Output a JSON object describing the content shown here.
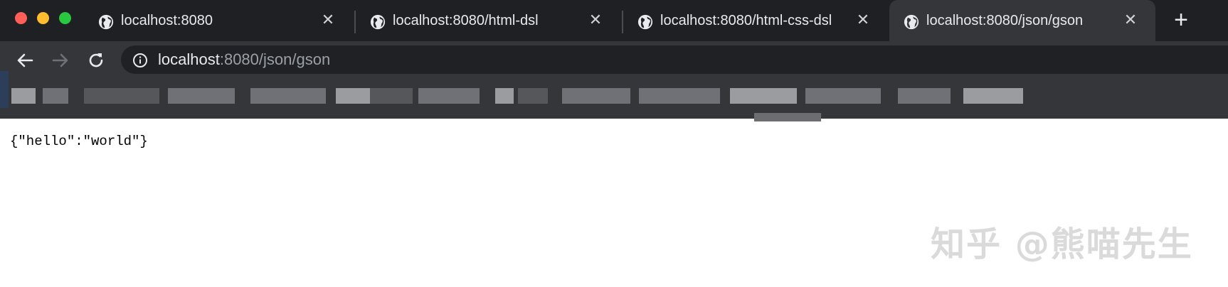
{
  "window": {
    "traffic_lights": [
      "close",
      "minimize",
      "maximize"
    ]
  },
  "tabs": [
    {
      "title": "localhost:8080",
      "icon": "globe-icon",
      "active": false
    },
    {
      "title": "localhost:8080/html-dsl",
      "icon": "globe-icon",
      "active": false
    },
    {
      "title": "localhost:8080/html-css-dsl",
      "icon": "globe-icon",
      "active": false
    },
    {
      "title": "localhost:8080/json/gson",
      "icon": "globe-icon",
      "active": true
    }
  ],
  "new_tab_label": "+",
  "toolbar": {
    "back_icon": "arrow-left-icon",
    "forward_icon": "arrow-right-icon",
    "reload_icon": "reload-icon",
    "site_info_icon": "info-icon",
    "url_host": "localhost",
    "url_path": ":8080/json/gson"
  },
  "page": {
    "body_text": "{\"hello\":\"world\"}"
  },
  "watermark": {
    "text": "知乎 @熊喵先生"
  },
  "colors": {
    "chrome_bg": "#1f2023",
    "toolbar_bg": "#35363a",
    "omnibox_bg": "#202124",
    "text_primary": "#e8eaed",
    "text_secondary": "#9aa0a6"
  }
}
